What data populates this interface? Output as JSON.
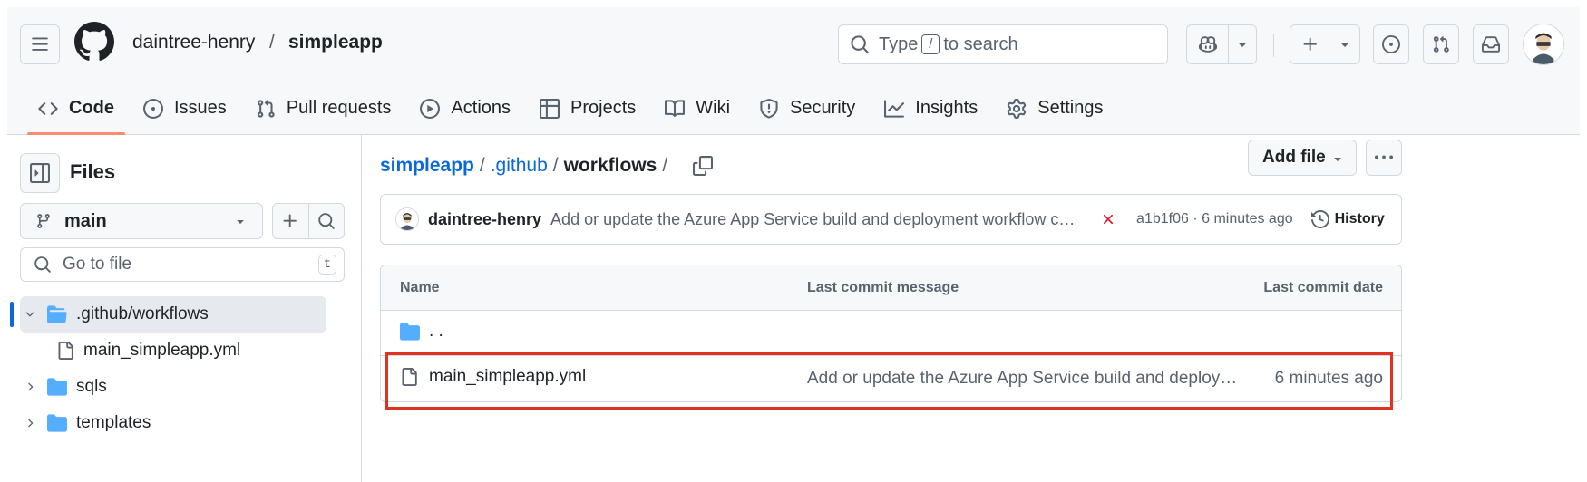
{
  "header": {
    "owner": "daintree-henry",
    "separator": "/",
    "repo": "simpleapp",
    "search": {
      "prefix": "Type",
      "key": "/",
      "suffix": "to search"
    }
  },
  "tabs": [
    {
      "label": "Code",
      "icon": "code-icon",
      "active": true
    },
    {
      "label": "Issues",
      "icon": "issue-opened-icon"
    },
    {
      "label": "Pull requests",
      "icon": "git-pull-request-icon"
    },
    {
      "label": "Actions",
      "icon": "play-icon"
    },
    {
      "label": "Projects",
      "icon": "table-icon"
    },
    {
      "label": "Wiki",
      "icon": "book-icon"
    },
    {
      "label": "Security",
      "icon": "shield-icon"
    },
    {
      "label": "Insights",
      "icon": "graph-icon"
    },
    {
      "label": "Settings",
      "icon": "gear-icon"
    }
  ],
  "sidebar": {
    "title": "Files",
    "branch": "main",
    "goto_placeholder": "Go to file",
    "goto_key": "t",
    "tree": [
      {
        "label": ".github/workflows",
        "type": "folder",
        "expanded": true,
        "active": true
      },
      {
        "label": "main_simpleapp.yml",
        "type": "file"
      },
      {
        "label": "sqls",
        "type": "folder",
        "expanded": false
      },
      {
        "label": "templates",
        "type": "folder",
        "expanded": false
      }
    ]
  },
  "main": {
    "breadcrumb": {
      "root": "simpleapp",
      "folder": ".github",
      "current": "workflows",
      "sep": "/"
    },
    "add_file_label": "Add file",
    "commit": {
      "author": "daintree-henry",
      "message": "Add or update the Azure App Service build and deployment workflow config",
      "status": "failure",
      "hash_time": "a1b1f06 · 6 minutes ago",
      "history_label": "History"
    },
    "table": {
      "headers": {
        "name": "Name",
        "message": "Last commit message",
        "date": "Last commit date"
      },
      "parent_dir": ". .",
      "rows": [
        {
          "name": "main_simpleapp.yml",
          "message": "Add or update the Azure App Service build and deployment workflow config",
          "date": "6 minutes ago"
        }
      ]
    }
  },
  "colors": {
    "accent_link": "#0969da",
    "tab_underline": "#fd8c73",
    "folder": "#54aeff",
    "fail": "#d1242f",
    "highlight_box": "#e0321e"
  }
}
